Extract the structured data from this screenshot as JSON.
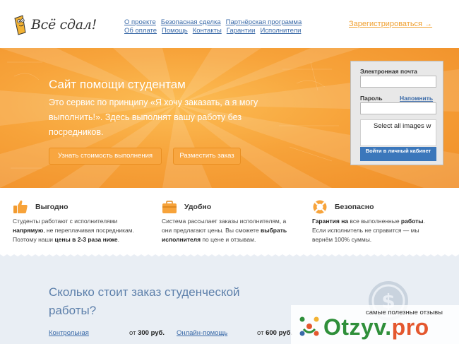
{
  "brand": {
    "logo_text": "Всё сдал!"
  },
  "nav": {
    "row1": [
      "О проекте",
      "Безопасная сделка",
      "Партнёрская программа"
    ],
    "row2": [
      "Об оплате",
      "Помощь",
      "Контакты",
      "Гарантии",
      "Исполнители"
    ]
  },
  "register_link": "Зарегистрироваться →",
  "hero": {
    "title": "Сайт помощи студентам",
    "description": "Это сервис по принципу «Я хочу заказать, а я могу выполнить!». Здесь выполнят вашу работу без посредников.",
    "btn_price": "Узнать стоимость выполнения",
    "btn_order": "Разместить заказ"
  },
  "login": {
    "email_label": "Электронная почта",
    "password_label": "Пароль",
    "forgot_link": "Напомнить",
    "captcha_text": "Select all images w",
    "submit_label": "Войти в личный кабинет"
  },
  "features": [
    {
      "title": "Выгодно",
      "icon": "thumbs-up-icon",
      "l1_a": "Студенты работают с исполнителями",
      "l2_b": "напрямую",
      "l2_a": ", не переплачивая посредникам.",
      "l3_a": "Поэтому наши ",
      "l3_b": "цены в 2-3 раза ниже",
      "l3_c": "."
    },
    {
      "title": "Удобно",
      "icon": "briefcase-icon",
      "l1_a": "Система рассылает заказы исполнителям, а",
      "l2_a": "они предлагают цены. Вы сможете ",
      "l2_b": "выбрать",
      "l3_b": "исполнителя",
      "l3_a": " по цене и отзывам."
    },
    {
      "title": "Безопасно",
      "icon": "lifebuoy-icon",
      "l1_b": "Гарантия на",
      "l1_a": " все выполненные ",
      "l1_c": "работы",
      "l2_a": "Если исполнитель не справится — мы",
      "l3_a": "вернём 100% суммы."
    }
  ],
  "pricing": {
    "title": "Сколько стоит заказ студенческой работы?",
    "rows": [
      {
        "name": "Контрольная",
        "from": "от ",
        "price": "300 руб."
      },
      {
        "name": "Онлайн-помощь",
        "from": "от ",
        "price": "600 руб."
      }
    ]
  },
  "watermark": {
    "caption": "самые полезные отзывы",
    "logo_main": "Otzyv.",
    "logo_accent": "pro"
  },
  "colors": {
    "accent_orange": "#f7a33a",
    "link_blue": "#3a6aa8",
    "login_button": "#3b77bb",
    "pricing_bg": "#e9eef4"
  }
}
